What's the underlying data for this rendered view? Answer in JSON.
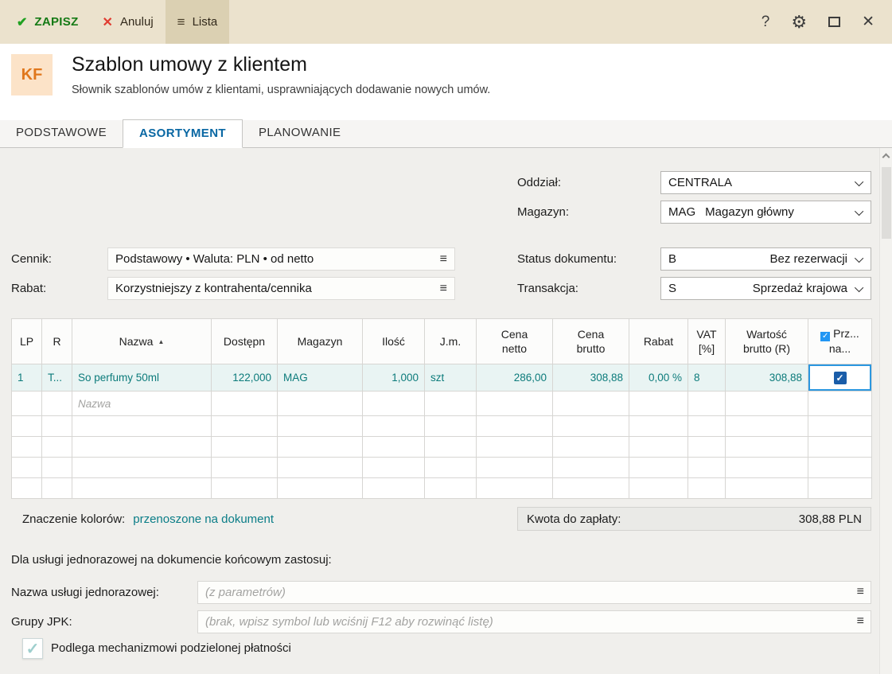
{
  "colors": {
    "toolbar_beige": "#ebe2cd",
    "save_green": "#157a15",
    "cancel_red": "#e03c31",
    "badge_orange": "#e0771c",
    "tab_active_blue": "#0967a3",
    "row_teal": "#0c7b7b",
    "legend_link_teal": "#0a7d87",
    "selection_blue": "#2b97e0"
  },
  "icons": {
    "check": "✔",
    "check_mark": "✓",
    "cancel": "✕",
    "menu": "≡",
    "help": "?",
    "gear": "⚙",
    "close": "✕",
    "sort_asc": "▲"
  },
  "toolbar": {
    "save_label": "ZAPISZ",
    "cancel_label": "Anuluj",
    "list_label": "Lista"
  },
  "header": {
    "badge": "KF",
    "title": "Szablon umowy z klientem",
    "subtitle": "Słownik szablonów umów z klientami, usprawniających dodawanie nowych umów."
  },
  "tabs": {
    "podstawowe": "PODSTAWOWE",
    "asortyment": "ASORTYMENT",
    "planowanie": "PLANOWANIE"
  },
  "form": {
    "oddzial": {
      "label": "Oddział:",
      "value": "CENTRALA"
    },
    "magazyn": {
      "label": "Magazyn:",
      "code": "MAG",
      "value": "Magazyn główny"
    },
    "cennik": {
      "label": "Cennik:",
      "value": "Podstawowy • Waluta: PLN • od netto"
    },
    "rabat": {
      "label": "Rabat:",
      "value": "Korzystniejszy z kontrahenta/cennika"
    },
    "status": {
      "label": "Status dokumentu:",
      "code": "B",
      "value": "Bez rezerwacji"
    },
    "transakcja": {
      "label": "Transakcja:",
      "code": "S",
      "value": "Sprzedaż krajowa"
    }
  },
  "table": {
    "headers": {
      "lp": "LP",
      "r": "R",
      "nazwa": "Nazwa",
      "dostepn": "Dostępn",
      "magazyn": "Magazyn",
      "ilosc": "Ilość",
      "jm": "J.m.",
      "cena_netto_l1": "Cena",
      "cena_netto_l2": "netto",
      "cena_brutto_l1": "Cena",
      "cena_brutto_l2": "brutto",
      "rabat": "Rabat",
      "vat_l1": "VAT",
      "vat_l2": "[%]",
      "wartosc_l1": "Wartość",
      "wartosc_l2": "brutto (R)",
      "prz_l1": "Prz...",
      "prz_l2": "na..."
    },
    "rows": [
      {
        "lp": "1",
        "r": "T...",
        "nazwa": "So perfumy 50ml",
        "dostepn": "122,000",
        "magazyn": "MAG",
        "ilosc": "1,000",
        "jm": "szt",
        "cena_netto": "286,00",
        "cena_brutto": "308,88",
        "rabat": "0,00 %",
        "vat": "8",
        "wartosc": "308,88"
      }
    ],
    "new_row_placeholder": "Nazwa"
  },
  "footer": {
    "legend_label": "Znaczenie kolorów:",
    "legend_link": "przenoszone na dokument",
    "kwota_label": "Kwota do zapłaty:",
    "kwota_value": "308,88 PLN"
  },
  "service": {
    "heading": "Dla usługi jednorazowej na dokumencie końcowym zastosuj:",
    "nazwa_label": "Nazwa usługi jednorazowej:",
    "nazwa_placeholder": "(z parametrów)",
    "jpk_label": "Grupy JPK:",
    "jpk_placeholder": "(brak, wpisz symbol lub wciśnij F12 aby rozwinąć listę)",
    "split_payment_label": "Podlega mechanizmowi podzielonej płatności"
  }
}
